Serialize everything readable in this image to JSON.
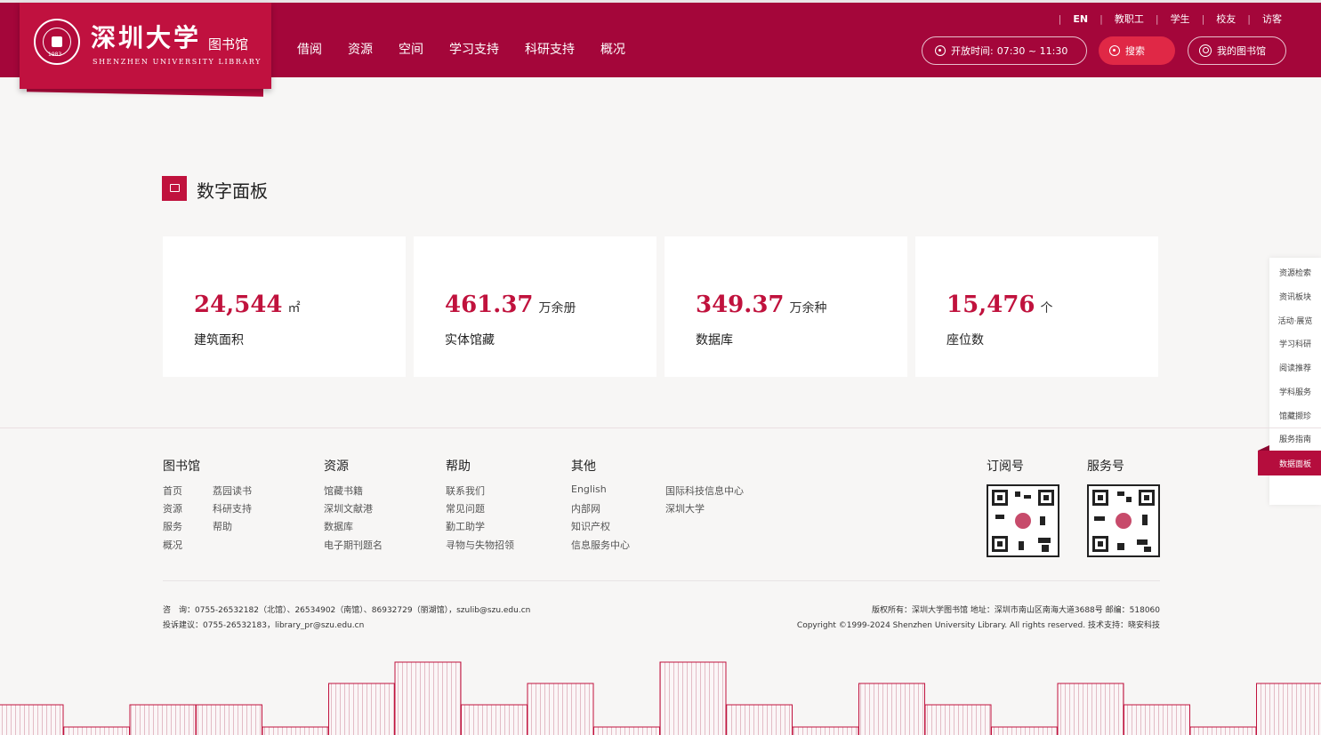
{
  "header": {
    "logo_cn": "深圳大学",
    "logo_cn_small": "图书馆",
    "logo_en": "SHENZHEN UNIVERSITY LIBRARY",
    "seal_year": "1983",
    "nav": [
      "借阅",
      "资源",
      "空间",
      "学习支持",
      "科研支持",
      "概况"
    ],
    "roles": [
      "EN",
      "教职工",
      "学生",
      "校友",
      "访客"
    ],
    "hours_prefix": "开放时间:",
    "hours_value": "07:30 ~ 11:30",
    "search_label": "搜索",
    "mylib_label": "我的图书馆"
  },
  "section": {
    "title": "数字面板"
  },
  "stats": [
    {
      "value": "24,544",
      "unit": "㎡",
      "label": "建筑面积"
    },
    {
      "value": "461.37",
      "unit": "万余册",
      "label": "实体馆藏"
    },
    {
      "value": "349.37",
      "unit": "万余种",
      "label": "数据库"
    },
    {
      "value": "15,476",
      "unit": "个",
      "label": "座位数"
    }
  ],
  "sidenav": {
    "items": [
      "资源检索",
      "资讯板块",
      "活动·展览",
      "学习科研",
      "阅读推荐",
      "学科服务",
      "馆藏撷珍",
      "服务指南"
    ],
    "active": "数据面板"
  },
  "footer": {
    "columns": [
      {
        "title": "图书馆",
        "links": [
          "首页",
          "资源",
          "服务",
          "概况",
          "荔园读书",
          "科研支持",
          "帮助"
        ]
      },
      {
        "title": "资源",
        "links": [
          "馆藏书籍",
          "深圳文献港",
          "数据库",
          "电子期刊题名"
        ]
      },
      {
        "title": "帮助",
        "links": [
          "联系我们",
          "常见问题",
          "勤工助学",
          "寻物与失物招领"
        ]
      },
      {
        "title": "其他",
        "links": [
          "English",
          "内部网",
          "知识产权",
          "信息服务中心",
          "国际科技信息中心",
          "深圳大学"
        ]
      }
    ],
    "qr": [
      {
        "title": "订阅号"
      },
      {
        "title": "服务号"
      }
    ],
    "consult": "咨　询：0755-26532182（北馆）、26534902（南馆）、86932729（丽湖馆），szulib@szu.edu.cn",
    "complaint": "投诉建议：0755-26532183，library_pr@szu.edu.cn",
    "rights": "版权所有：深圳大学图书馆 地址：深圳市南山区南海大道3688号 邮编：518060",
    "copyright": "Copyright ©1999-2024 Shenzhen University Library. All rights reserved. 技术支持：晓安科技"
  }
}
